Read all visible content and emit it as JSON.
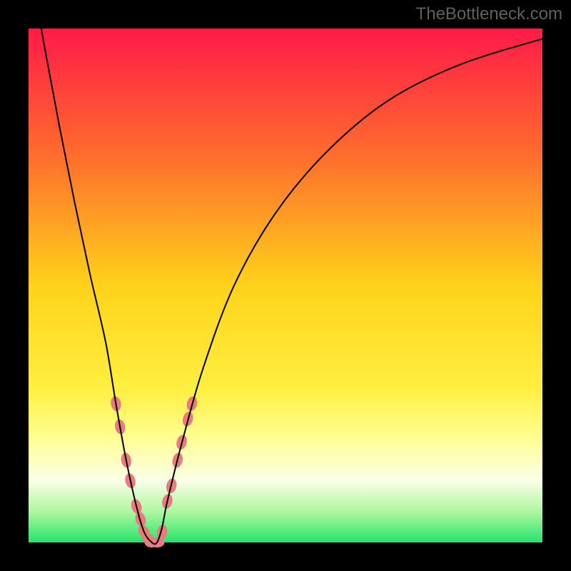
{
  "watermark": "TheBottleneck.com",
  "chart_data": {
    "type": "line",
    "title": "",
    "xlabel": "",
    "ylabel": "",
    "xlim": [
      0,
      100
    ],
    "ylim": [
      0,
      100
    ],
    "gradient_stops": [
      {
        "pct": 0,
        "color": "#ff1a48"
      },
      {
        "pct": 24,
        "color": "#ff6a2e"
      },
      {
        "pct": 50,
        "color": "#ffd21a"
      },
      {
        "pct": 70,
        "color": "#ffef40"
      },
      {
        "pct": 80,
        "color": "#ffff95"
      },
      {
        "pct": 88,
        "color": "#faffe8"
      },
      {
        "pct": 94,
        "color": "#aef7a0"
      },
      {
        "pct": 100,
        "color": "#26e36a"
      }
    ],
    "series": [
      {
        "name": "bottleneck-curve",
        "color": "#000000",
        "stroke_width": 2,
        "x": [
          0,
          3,
          6,
          9,
          12,
          15,
          17,
          19,
          21,
          22.5,
          24,
          25,
          26,
          27,
          30,
          34,
          40,
          48,
          58,
          70,
          84,
          100
        ],
        "values": [
          114,
          97,
          81,
          66,
          52,
          39,
          27,
          16,
          7,
          2,
          0,
          0,
          3,
          8,
          20,
          34,
          50,
          64,
          76,
          86,
          93,
          98
        ]
      }
    ],
    "marker_clusters": [
      {
        "name": "left-arm-markers",
        "color": "#e77b7d",
        "radius": 7,
        "points": [
          {
            "x": 17.0,
            "y": 27.0
          },
          {
            "x": 17.8,
            "y": 22.5
          },
          {
            "x": 19.0,
            "y": 16.0
          },
          {
            "x": 19.8,
            "y": 12.0
          },
          {
            "x": 21.0,
            "y": 7.0
          },
          {
            "x": 21.8,
            "y": 4.5
          },
          {
            "x": 22.5,
            "y": 2.0
          },
          {
            "x": 23.3,
            "y": 0.7
          },
          {
            "x": 24.0,
            "y": 0.0
          },
          {
            "x": 25.0,
            "y": 0.0
          }
        ]
      },
      {
        "name": "right-arm-markers",
        "color": "#e77b7d",
        "radius": 7,
        "points": [
          {
            "x": 26.0,
            "y": 2.0
          },
          {
            "x": 27.0,
            "y": 8.0
          },
          {
            "x": 27.8,
            "y": 11.0
          },
          {
            "x": 29.0,
            "y": 16.0
          },
          {
            "x": 29.8,
            "y": 19.5
          },
          {
            "x": 31.0,
            "y": 24.0
          },
          {
            "x": 31.8,
            "y": 27.0
          }
        ]
      }
    ]
  }
}
